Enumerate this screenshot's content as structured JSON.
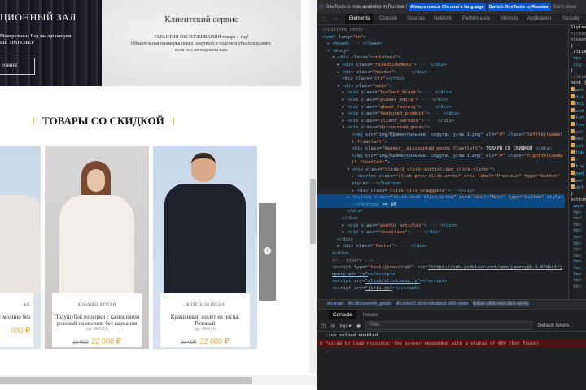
{
  "page": {
    "banner": {
      "title": "ЦИОННЫЙ ЗАЛ",
      "text1": "Минеральных Вод мы организуем",
      "text2": "ЫЙ ТРАНСФЕР",
      "button": "РОВНЕЕ"
    },
    "service": {
      "title": "Клиентский сервис",
      "line1": "ГАРАНТИЯ ОБСЛУЖИВАНИЯ товара 1 год!",
      "line2": "Обязательная примерка перед покупкой и подгон шубы под размер,",
      "line3": "если она не подошла вам."
    },
    "discount_heading": "ТОВАРЫ СО СКИДКОЙ",
    "products": [
      {
        "category": "ЫЕ",
        "name": "норки с молнии без",
        "article": "",
        "old_price": "",
        "price": "000 ₽"
      },
      {
        "category": "КОЖАНЫЕ КУРТКИ",
        "name": "Полушубок из норки с капюшоном розовый на молнии без карманов",
        "article": "Арт. 00001234",
        "old_price": "25 000",
        "price": "22 000 ₽"
      },
      {
        "category": "ЖИЛЕТЫ ИЗ ПЕСЦА",
        "name": "Крашенный жилет из песца. Розовый",
        "article": "Арт. 00001234",
        "old_price": "25 000",
        "price": "22 000 ₽"
      }
    ],
    "next_arrow": "›"
  },
  "devtools": {
    "infobar": {
      "text": "DevTools is now available in Russian!",
      "btn1": "Always match Chrome's language",
      "btn2": "Switch DevTools to Russian",
      "btn3": "Don't show"
    },
    "tabs": [
      "Elements",
      "Console",
      "Sources",
      "Network",
      "Performance",
      "Memory",
      "Application",
      "Security"
    ],
    "dom": {
      "l1": "<!DOCTYPE html>",
      "l2a": "<html ",
      "l2b": "lang",
      "l2c": "\"en\"",
      "l2d": ">",
      "head": "▸ <head> ··· </head>",
      "body": "▾ <body>",
      "classes": [
        "container",
        "fixedSideMenu",
        "header",
        "clr",
        "main",
        "furCoat_block",
        "pluses_edita",
        "about_factory",
        "featured_product",
        "client_service",
        "discounted_goods"
      ],
      "img_src": "img/Прямоугольник. скруга. углы 1.png",
      "img_alt": "\"#\"",
      "left_cls": "\"leftYellowWall floatleft\"",
      "hdr_cls": "\"header__discounted_goods floatleft\"",
      "hdr_text": "ТОВАРЫ СО СКИДКОЙ",
      "right_cls": "\"rightYellowWall floatleft\"",
      "slider_cls": "\"slider2 slick-initialized slick-slider\"",
      "prev_line": "\"slick-prev slick-arrow\" aria-label=\"Previous\" type=\"button\"",
      "list_cls": "\"slick-list draggable\"",
      "next_line": "\"slick-next slick-arrow\" aria-label=\"Next\" type=\"button\"",
      "eq": "== $0",
      "useful": "useful_articles",
      "novelties": "novelties",
      "footer": "footer",
      "comment": "<!-- jquery -->",
      "jq_src": "https://cdn.jsdelivr.net/npm/jquery@3.6.0/dist/jquery.min.js",
      "slick_src": "slick/slick.min.js",
      "js_src": "js/js.js"
    },
    "styles": {
      "tab": "Styles",
      "filter": "Filter",
      "element": "element",
      "rule1": ".slick",
      "p1": "top",
      "p2": "rig",
      "rule2": ".slick",
      "rule2b": "next {",
      "props": [
        "pos",
        "dis",
        "hei",
        "wid",
        "lin",
        "fon",
        "cur",
        "bac",
        "col",
        "top",
        "—",
        "tra",
        "pad",
        "bor",
        "out"
      ],
      "rule3": "button",
      "props3": [
        "appe",
        "fon",
        "fon",
        "fon",
        "fon",
        "fon",
        "fon",
        "fon",
        "fon",
        "fon",
        "fon",
        "fon",
        "fon",
        "fon"
      ]
    },
    "breadcrumbs": [
      "div.main",
      "div.discounted_goods",
      "div.slider2.slick-initialized.slick-slider",
      "button.slick-next.slick-arrow"
    ],
    "console": {
      "tabs": [
        "Console",
        "Issues"
      ],
      "context": "top ▾",
      "filter_placeholder": "Filter",
      "levels": "Default levels",
      "log": "Live reload enabled.",
      "error": "Failed to load resource: the server responded with a status of 404 (Not Found)",
      "prompt": "›"
    },
    "colors": {
      "accent": "#0b57d0",
      "error_bg": "#4e1414",
      "error_text": "#f28b82",
      "price": "#d6a93a"
    }
  }
}
